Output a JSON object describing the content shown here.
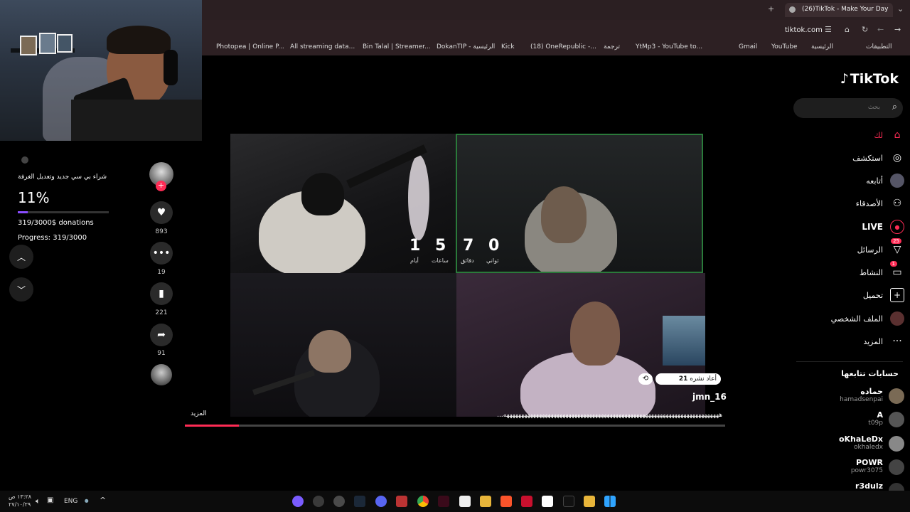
{
  "browser": {
    "tab_title": "(26)TikTok - Make Your Day",
    "url": "tiktok.com",
    "bookmarks": [
      "Photopea | Online P...",
      "All streaming data...",
      "Bin Talal | Streamer...",
      "DokanTIP - الرئيسية",
      "Kick",
      "(18) OneRepublic -...",
      "ترجمة",
      "YtMp3 - YouTube to...",
      "Gmail",
      "YouTube",
      "الرئيسية",
      "التطبيقات"
    ]
  },
  "overlay": {
    "goal_title": "شراء بي سي جديد وتعديل الغرفة",
    "percent": "11%",
    "progress_fraction": 0.11,
    "donations": "319/3000$ donations",
    "progress": "Progress: 319/3000"
  },
  "timer": {
    "values": [
      "1",
      "5",
      "7",
      "0"
    ],
    "labels": [
      "أيام",
      "ساعات",
      "دقائق",
      "ثواني"
    ]
  },
  "actions": {
    "likes": "893",
    "comments": "19",
    "saves": "221",
    "shares": "91"
  },
  "post": {
    "repost_label": "أعاد نشره",
    "repost_count": "21",
    "username": "jmn_16",
    "caption": "هههههههههههههههههههههههههههههههههههههههههههههههههههههههههههههههههههههههههه...",
    "more_label": "المزيد",
    "progress_fraction": 0.1
  },
  "sidebar": {
    "logo": "TikTok",
    "search_placeholder": "بحث",
    "nav": [
      {
        "label": "لك",
        "icon": "home-icon"
      },
      {
        "label": "استكشف",
        "icon": "compass-icon"
      },
      {
        "label": "أتابعه",
        "icon": "following-icon"
      },
      {
        "label": "الأصدقاء",
        "icon": "friends-icon"
      },
      {
        "label": "LIVE",
        "icon": "live-icon"
      },
      {
        "label": "الرسائل",
        "icon": "messages-icon",
        "badge": "25"
      },
      {
        "label": "النشاط",
        "icon": "activity-icon",
        "badge": "1"
      },
      {
        "label": "تحميل",
        "icon": "upload-icon"
      },
      {
        "label": "الملف الشخصي",
        "icon": "profile-icon"
      },
      {
        "label": "المزيد",
        "icon": "more-icon"
      }
    ],
    "following_title": "حسابات تتابعها",
    "accounts": [
      {
        "name": "حماده",
        "handle": "hamadsenpai"
      },
      {
        "name": "A",
        "handle": "t09p"
      },
      {
        "name": "oKhaLeDx",
        "handle": "okhaledx"
      },
      {
        "name": "POWR",
        "handle": "powr3075"
      },
      {
        "name": "r3dulz",
        "handle": ""
      }
    ]
  },
  "taskbar": {
    "time": "١٣:٢٨ ص",
    "date": "٢٧/١٠/٢٩",
    "lang": "ENG"
  },
  "colors": {
    "tiktok_red": "#fe2c55",
    "accent_purple": "#8a4dff"
  }
}
